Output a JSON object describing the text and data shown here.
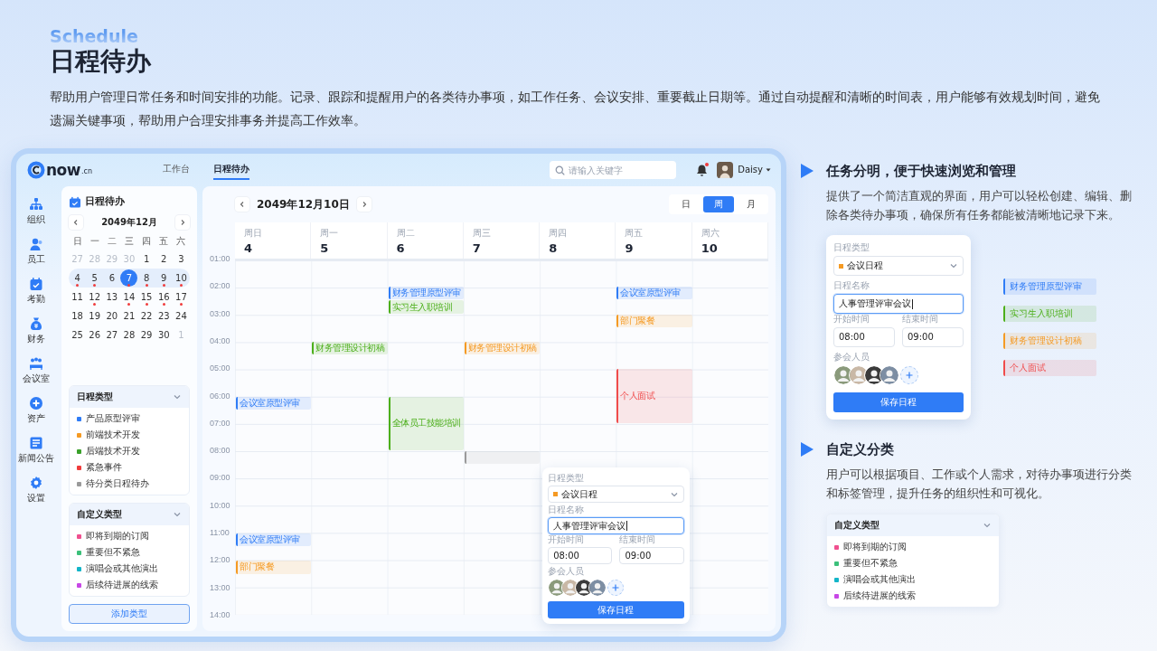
{
  "intro": {
    "eyebrow": "Schedule",
    "title": "日程待办",
    "description": "帮助用户管理日常任务和时间安排的功能。记录、跟踪和提醒用户的各类待办事项，如工作任务、会议安排、重要截止日期等。通过自动提醒和清晰的时间表，用户能够有效规划时间，避免遗漏关键事项，帮助用户合理安排事务并提高工作效率。"
  },
  "app": {
    "logo": {
      "text": "now",
      "suffix": ".cn"
    },
    "top_tabs": [
      {
        "label": "工作台",
        "selected": false
      },
      {
        "label": "日程待办",
        "selected": true
      }
    ],
    "search": {
      "placeholder": "请输入关键字"
    },
    "notifications": {
      "unread": true
    },
    "user": {
      "name": "Daisy"
    },
    "sidebar": {
      "items": [
        {
          "label": "组织"
        },
        {
          "label": "员工"
        },
        {
          "label": "考勤"
        },
        {
          "label": "财务"
        },
        {
          "label": "会议室"
        },
        {
          "label": "资产"
        },
        {
          "label": "新闻公告"
        },
        {
          "label": "设置"
        }
      ]
    },
    "panel": {
      "title": "日程待办",
      "month": "2049年12月",
      "weekdays": [
        "日",
        "一",
        "二",
        "三",
        "四",
        "五",
        "六"
      ],
      "weeks": [
        {
          "highlighted": false,
          "days": [
            {
              "day": "27",
              "muted": true,
              "dot": false,
              "selected": false
            },
            {
              "day": "28",
              "muted": true,
              "dot": false,
              "selected": false
            },
            {
              "day": "29",
              "muted": true,
              "dot": false,
              "selected": false
            },
            {
              "day": "30",
              "muted": true,
              "dot": false,
              "selected": false
            },
            {
              "day": "1",
              "muted": false,
              "dot": false,
              "selected": false
            },
            {
              "day": "2",
              "muted": false,
              "dot": false,
              "selected": false
            },
            {
              "day": "3",
              "muted": false,
              "dot": false,
              "selected": false
            }
          ]
        },
        {
          "highlighted": true,
          "days": [
            {
              "day": "4",
              "muted": false,
              "dot": true,
              "selected": false
            },
            {
              "day": "5",
              "muted": false,
              "dot": true,
              "selected": false
            },
            {
              "day": "6",
              "muted": false,
              "dot": false,
              "selected": false
            },
            {
              "day": "7",
              "muted": false,
              "dot": true,
              "selected": true
            },
            {
              "day": "8",
              "muted": false,
              "dot": true,
              "selected": false
            },
            {
              "day": "9",
              "muted": false,
              "dot": true,
              "selected": false
            },
            {
              "day": "10",
              "muted": false,
              "dot": true,
              "selected": false
            }
          ]
        },
        {
          "highlighted": false,
          "days": [
            {
              "day": "11",
              "muted": false,
              "dot": false,
              "selected": false
            },
            {
              "day": "12",
              "muted": false,
              "dot": true,
              "selected": false
            },
            {
              "day": "13",
              "muted": false,
              "dot": false,
              "selected": false
            },
            {
              "day": "14",
              "muted": false,
              "dot": true,
              "selected": false
            },
            {
              "day": "15",
              "muted": false,
              "dot": true,
              "selected": false
            },
            {
              "day": "16",
              "muted": false,
              "dot": true,
              "selected": false
            },
            {
              "day": "17",
              "muted": false,
              "dot": true,
              "selected": false
            }
          ]
        },
        {
          "highlighted": false,
          "days": [
            {
              "day": "18",
              "muted": false,
              "dot": false,
              "selected": false
            },
            {
              "day": "19",
              "muted": false,
              "dot": false,
              "selected": false
            },
            {
              "day": "20",
              "muted": false,
              "dot": false,
              "selected": false
            },
            {
              "day": "21",
              "muted": false,
              "dot": false,
              "selected": false
            },
            {
              "day": "22",
              "muted": false,
              "dot": false,
              "selected": false
            },
            {
              "day": "23",
              "muted": false,
              "dot": false,
              "selected": false
            },
            {
              "day": "24",
              "muted": false,
              "dot": false,
              "selected": false
            }
          ]
        },
        {
          "highlighted": false,
          "days": [
            {
              "day": "25",
              "muted": false,
              "dot": false,
              "selected": false
            },
            {
              "day": "26",
              "muted": false,
              "dot": false,
              "selected": false
            },
            {
              "day": "27",
              "muted": false,
              "dot": false,
              "selected": false
            },
            {
              "day": "28",
              "muted": false,
              "dot": false,
              "selected": false
            },
            {
              "day": "29",
              "muted": false,
              "dot": false,
              "selected": false
            },
            {
              "day": "30",
              "muted": false,
              "dot": false,
              "selected": false
            },
            {
              "day": "1",
              "muted": true,
              "dot": false,
              "selected": false
            }
          ]
        }
      ],
      "type_groups": [
        {
          "title": "日程类型",
          "expanded": true,
          "items": [
            {
              "label": "产品原型评审",
              "color": "#2f7cf6"
            },
            {
              "label": "前端技术开发",
              "color": "#f59a23"
            },
            {
              "label": "后端技术开发",
              "color": "#3aa12a"
            },
            {
              "label": "紧急事件",
              "color": "#f03c3c"
            },
            {
              "label": "待分类日程待办",
              "color": "#9a9a9a"
            }
          ]
        },
        {
          "title": "自定义类型",
          "expanded": true,
          "items": [
            {
              "label": "即将到期的订阅",
              "color": "#f0508f"
            },
            {
              "label": "重要但不紧急",
              "color": "#3cc07a"
            },
            {
              "label": "演唱会或其他演出",
              "color": "#13b5c8"
            },
            {
              "label": "后续待进展的线索",
              "color": "#c847e6"
            }
          ]
        }
      ],
      "add_button": "添加类型"
    },
    "calendar": {
      "date": "2049年12月10日",
      "views": [
        {
          "label": "日",
          "selected": false
        },
        {
          "label": "周",
          "selected": true
        },
        {
          "label": "月",
          "selected": false
        }
      ],
      "days": [
        {
          "weekday": "周日",
          "date": "4"
        },
        {
          "weekday": "周一",
          "date": "5"
        },
        {
          "weekday": "周二",
          "date": "6"
        },
        {
          "weekday": "周三",
          "date": "7"
        },
        {
          "weekday": "周四",
          "date": "8"
        },
        {
          "weekday": "周五",
          "date": "9"
        },
        {
          "weekday": "周六",
          "date": "10"
        }
      ],
      "times": [
        {
          "label": "01:00"
        },
        {
          "label": "02:00",
          "cells": [
            null,
            null,
            [
              {
                "kind": "early",
                "title": "财务管理原型评审",
                "color": "#2f7cf6"
              },
              {
                "kind": "late",
                "title": "实习生入职培训",
                "color": "#4caf1a"
              }
            ],
            null,
            null,
            [
              {
                "kind": "early",
                "title": "会议室原型评审",
                "color": "#2f7cf6"
              }
            ],
            null
          ]
        },
        {
          "label": "03:00",
          "cells": [
            null,
            null,
            null,
            null,
            null,
            [
              {
                "kind": "early",
                "title": "部门聚餐",
                "color": "#f59a23"
              }
            ],
            null
          ]
        },
        {
          "label": "04:00",
          "cells": [
            null,
            [
              {
                "kind": "early",
                "title": "财务管理设计初稿",
                "color": "#4caf1a"
              }
            ],
            null,
            [
              {
                "kind": "early",
                "title": "财务管理设计初稿",
                "color": "#f59a23"
              }
            ],
            null,
            null,
            null
          ]
        },
        {
          "label": "05:00",
          "cells": [
            null,
            null,
            null,
            null,
            null,
            [
              {
                "kind": "long",
                "title": "个人面试",
                "color": "#f04b4b"
              }
            ],
            null
          ]
        },
        {
          "label": "06:00",
          "cells": [
            [
              {
                "kind": "early",
                "title": "会议室原型评审",
                "color": "#2f7cf6"
              }
            ],
            null,
            [
              {
                "kind": "long",
                "title": "全体员工技能培训",
                "color": "#4caf1a"
              }
            ],
            null,
            null,
            null,
            null
          ]
        },
        {
          "label": "07:00"
        },
        {
          "label": "08:00",
          "cells": [
            null,
            null,
            null,
            [
              {
                "kind": "early",
                "color": "#9a9a9a"
              }
            ],
            null,
            null,
            null
          ]
        },
        {
          "label": "09:00"
        },
        {
          "label": "10:00"
        },
        {
          "label": "11:00",
          "cells": [
            [
              {
                "kind": "early",
                "title": "会议室原型评审",
                "color": "#2f7cf6"
              }
            ],
            null,
            null,
            null,
            null,
            null,
            null
          ]
        },
        {
          "label": "12:00",
          "cells": [
            [
              {
                "kind": "early",
                "title": "部门聚餐",
                "color": "#f59a23"
              }
            ],
            null,
            null,
            null,
            null,
            null,
            null
          ]
        },
        {
          "label": "13:00"
        },
        {
          "label": "14:00"
        }
      ],
      "popover": {
        "type_label": "日程类型",
        "type_option": {
          "label": "会议日程",
          "color": "#f59a23"
        },
        "name_label": "日程名称",
        "name_value": "人事管理评审会议",
        "focused": true,
        "start_label": "开始时间",
        "start_value": "08:00",
        "end_label": "结束时间",
        "end_value": "09:00",
        "attendees_label": "参会人员",
        "save": "保存日程"
      }
    }
  },
  "features": [
    {
      "title": "任务分明，便于快速浏览和管理",
      "text": "提供了一个简洁直观的界面，用户可以轻松创建、编辑、删除各类待办事项，确保所有任务都能被清晰地记录下来。",
      "form": {
        "type_label": "日程类型",
        "type_option": {
          "label": "会议日程",
          "color": "#f59a23"
        },
        "name_label": "日程名称",
        "name_value": "人事管理评审会议",
        "focused": true,
        "start_label": "开始时间",
        "start_value": "08:00",
        "end_label": "结束时间",
        "end_value": "09:00",
        "attendees_label": "参会人员",
        "save": "保存日程"
      },
      "chips": [
        {
          "label": "财务管理原型评审",
          "color": "#2f7cf6"
        },
        {
          "label": "实习生入职培训",
          "color": "#4caf1a"
        },
        {
          "label": "财务管理设计初稿",
          "color": "#f59a23"
        },
        {
          "label": "个人面试",
          "color": "#f04b4b"
        }
      ]
    },
    {
      "title": "自定义分类",
      "text": "用户可以根据项目、工作或个人需求，对待办事项进行分类和标签管理，提升任务的组织性和可视化。",
      "type_card": {
        "title": "自定义类型",
        "expanded": true,
        "items": [
          {
            "label": "即将到期的订阅",
            "color": "#f0508f"
          },
          {
            "label": "重要但不紧急",
            "color": "#3cc07a"
          },
          {
            "label": "演唱会或其他演出",
            "color": "#13b5c8"
          },
          {
            "label": "后续待进展的线索",
            "color": "#c847e6"
          }
        ]
      }
    }
  ]
}
